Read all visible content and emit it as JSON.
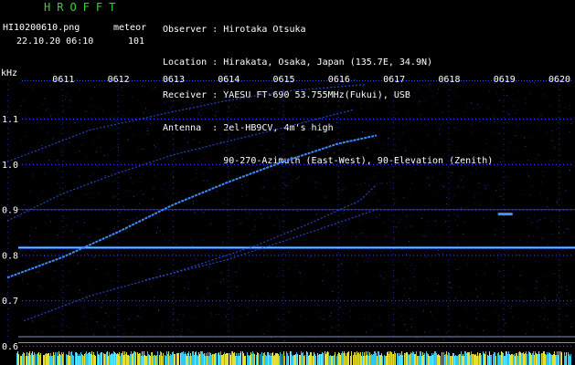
{
  "header": {
    "app_title": "HROFFT",
    "file_name": "HI10200610.png",
    "datetime": "22.10.20 06:10",
    "meteor_label": "meteor",
    "meteor_count": "101",
    "observer_line": "Observer : Hirotaka Otsuka",
    "location_line": "Location : Hirakata, Osaka, Japan (135.7E, 34.9N)",
    "receiver_line": "Receiver : YAESU FT-690 53.755MHz(Fukui), USB",
    "antenna_line": "Antenna  : 2el-HB9CV, 4m's high",
    "antenna_line2": "           90-270-Azimuth (East-West), 90-Elevation (Zenith)"
  },
  "chart_data": {
    "type": "spectrogram",
    "ylabel": "kHz",
    "x_ticks": [
      "0611",
      "0612",
      "0613",
      "0614",
      "0615",
      "0616",
      "0617",
      "0618",
      "0619",
      "0620"
    ],
    "y_ticks": [
      "1.1",
      "1.0",
      "0.9",
      "0.8",
      "0.7",
      "0.6"
    ],
    "x_range_minutes": [
      0,
      10
    ],
    "y_range_khz": [
      0.595,
      1.175
    ],
    "colors": {
      "background": "#000000",
      "tick_text": "#ffffff",
      "grid_dots": "#2a55ff",
      "trace_main": "#3a8cff",
      "trace_faint": "#2850e0",
      "carrier_line": "#c8d238",
      "carrier_glow": "#2a7cff",
      "ref_line": "#8090c0",
      "bottom_bar_a": "#e8e030",
      "bottom_bar_b": "#30c8f0"
    },
    "horizontal_lines_khz": [
      {
        "freq": 0.9,
        "style": "faint"
      },
      {
        "freq": 0.816,
        "style": "carrier"
      },
      {
        "freq": 0.62,
        "style": "ref"
      },
      {
        "freq": 0.607,
        "style": "ref"
      }
    ],
    "traces": [
      {
        "points": [
          [
            0,
            1.005
          ],
          [
            1.5,
            1.075
          ],
          [
            3,
            1.115
          ],
          [
            4,
            1.14
          ],
          [
            5,
            1.16
          ],
          [
            6.5,
            1.175
          ]
        ],
        "style": "faint"
      },
      {
        "points": [
          [
            0,
            0.875
          ],
          [
            1,
            0.935
          ],
          [
            2,
            0.98
          ],
          [
            3,
            1.02
          ],
          [
            4,
            1.05
          ],
          [
            5,
            1.08
          ],
          [
            6.3,
            1.12
          ]
        ],
        "style": "faint"
      },
      {
        "points": [
          [
            0,
            0.75
          ],
          [
            1,
            0.795
          ],
          [
            2,
            0.85
          ],
          [
            3,
            0.91
          ],
          [
            4,
            0.96
          ],
          [
            5,
            1.005
          ],
          [
            6,
            1.045
          ],
          [
            6.7,
            1.063
          ]
        ],
        "style": "main"
      },
      {
        "points": [
          [
            0.3,
            0.655
          ],
          [
            1.5,
            0.71
          ],
          [
            3,
            0.76
          ],
          [
            4.5,
            0.82
          ],
          [
            5.5,
            0.87
          ],
          [
            6.4,
            0.92
          ],
          [
            6.7,
            0.955
          ]
        ],
        "style": "faint"
      },
      {
        "points": [
          [
            2.5,
            0.745
          ],
          [
            4,
            0.79
          ],
          [
            5.5,
            0.85
          ],
          [
            6.7,
            0.9
          ]
        ],
        "style": "faint"
      }
    ]
  }
}
